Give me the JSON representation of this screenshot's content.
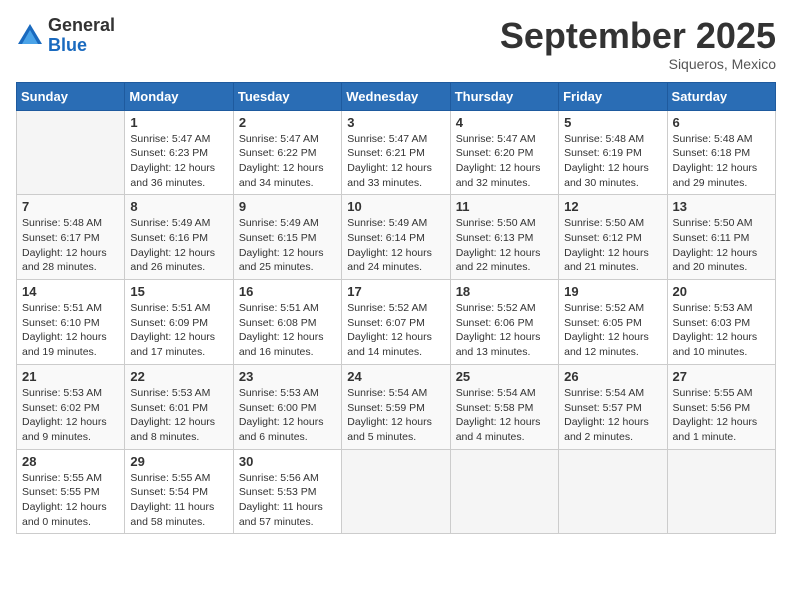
{
  "logo": {
    "general": "General",
    "blue": "Blue"
  },
  "title": {
    "month_year": "September 2025",
    "location": "Siqueros, Mexico"
  },
  "weekdays": [
    "Sunday",
    "Monday",
    "Tuesday",
    "Wednesday",
    "Thursday",
    "Friday",
    "Saturday"
  ],
  "weeks": [
    [
      {
        "day": "",
        "sunrise": "",
        "sunset": "",
        "daylight": ""
      },
      {
        "day": "1",
        "sunrise": "Sunrise: 5:47 AM",
        "sunset": "Sunset: 6:23 PM",
        "daylight": "Daylight: 12 hours and 36 minutes."
      },
      {
        "day": "2",
        "sunrise": "Sunrise: 5:47 AM",
        "sunset": "Sunset: 6:22 PM",
        "daylight": "Daylight: 12 hours and 34 minutes."
      },
      {
        "day": "3",
        "sunrise": "Sunrise: 5:47 AM",
        "sunset": "Sunset: 6:21 PM",
        "daylight": "Daylight: 12 hours and 33 minutes."
      },
      {
        "day": "4",
        "sunrise": "Sunrise: 5:47 AM",
        "sunset": "Sunset: 6:20 PM",
        "daylight": "Daylight: 12 hours and 32 minutes."
      },
      {
        "day": "5",
        "sunrise": "Sunrise: 5:48 AM",
        "sunset": "Sunset: 6:19 PM",
        "daylight": "Daylight: 12 hours and 30 minutes."
      },
      {
        "day": "6",
        "sunrise": "Sunrise: 5:48 AM",
        "sunset": "Sunset: 6:18 PM",
        "daylight": "Daylight: 12 hours and 29 minutes."
      }
    ],
    [
      {
        "day": "7",
        "sunrise": "Sunrise: 5:48 AM",
        "sunset": "Sunset: 6:17 PM",
        "daylight": "Daylight: 12 hours and 28 minutes."
      },
      {
        "day": "8",
        "sunrise": "Sunrise: 5:49 AM",
        "sunset": "Sunset: 6:16 PM",
        "daylight": "Daylight: 12 hours and 26 minutes."
      },
      {
        "day": "9",
        "sunrise": "Sunrise: 5:49 AM",
        "sunset": "Sunset: 6:15 PM",
        "daylight": "Daylight: 12 hours and 25 minutes."
      },
      {
        "day": "10",
        "sunrise": "Sunrise: 5:49 AM",
        "sunset": "Sunset: 6:14 PM",
        "daylight": "Daylight: 12 hours and 24 minutes."
      },
      {
        "day": "11",
        "sunrise": "Sunrise: 5:50 AM",
        "sunset": "Sunset: 6:13 PM",
        "daylight": "Daylight: 12 hours and 22 minutes."
      },
      {
        "day": "12",
        "sunrise": "Sunrise: 5:50 AM",
        "sunset": "Sunset: 6:12 PM",
        "daylight": "Daylight: 12 hours and 21 minutes."
      },
      {
        "day": "13",
        "sunrise": "Sunrise: 5:50 AM",
        "sunset": "Sunset: 6:11 PM",
        "daylight": "Daylight: 12 hours and 20 minutes."
      }
    ],
    [
      {
        "day": "14",
        "sunrise": "Sunrise: 5:51 AM",
        "sunset": "Sunset: 6:10 PM",
        "daylight": "Daylight: 12 hours and 19 minutes."
      },
      {
        "day": "15",
        "sunrise": "Sunrise: 5:51 AM",
        "sunset": "Sunset: 6:09 PM",
        "daylight": "Daylight: 12 hours and 17 minutes."
      },
      {
        "day": "16",
        "sunrise": "Sunrise: 5:51 AM",
        "sunset": "Sunset: 6:08 PM",
        "daylight": "Daylight: 12 hours and 16 minutes."
      },
      {
        "day": "17",
        "sunrise": "Sunrise: 5:52 AM",
        "sunset": "Sunset: 6:07 PM",
        "daylight": "Daylight: 12 hours and 14 minutes."
      },
      {
        "day": "18",
        "sunrise": "Sunrise: 5:52 AM",
        "sunset": "Sunset: 6:06 PM",
        "daylight": "Daylight: 12 hours and 13 minutes."
      },
      {
        "day": "19",
        "sunrise": "Sunrise: 5:52 AM",
        "sunset": "Sunset: 6:05 PM",
        "daylight": "Daylight: 12 hours and 12 minutes."
      },
      {
        "day": "20",
        "sunrise": "Sunrise: 5:53 AM",
        "sunset": "Sunset: 6:03 PM",
        "daylight": "Daylight: 12 hours and 10 minutes."
      }
    ],
    [
      {
        "day": "21",
        "sunrise": "Sunrise: 5:53 AM",
        "sunset": "Sunset: 6:02 PM",
        "daylight": "Daylight: 12 hours and 9 minutes."
      },
      {
        "day": "22",
        "sunrise": "Sunrise: 5:53 AM",
        "sunset": "Sunset: 6:01 PM",
        "daylight": "Daylight: 12 hours and 8 minutes."
      },
      {
        "day": "23",
        "sunrise": "Sunrise: 5:53 AM",
        "sunset": "Sunset: 6:00 PM",
        "daylight": "Daylight: 12 hours and 6 minutes."
      },
      {
        "day": "24",
        "sunrise": "Sunrise: 5:54 AM",
        "sunset": "Sunset: 5:59 PM",
        "daylight": "Daylight: 12 hours and 5 minutes."
      },
      {
        "day": "25",
        "sunrise": "Sunrise: 5:54 AM",
        "sunset": "Sunset: 5:58 PM",
        "daylight": "Daylight: 12 hours and 4 minutes."
      },
      {
        "day": "26",
        "sunrise": "Sunrise: 5:54 AM",
        "sunset": "Sunset: 5:57 PM",
        "daylight": "Daylight: 12 hours and 2 minutes."
      },
      {
        "day": "27",
        "sunrise": "Sunrise: 5:55 AM",
        "sunset": "Sunset: 5:56 PM",
        "daylight": "Daylight: 12 hours and 1 minute."
      }
    ],
    [
      {
        "day": "28",
        "sunrise": "Sunrise: 5:55 AM",
        "sunset": "Sunset: 5:55 PM",
        "daylight": "Daylight: 12 hours and 0 minutes."
      },
      {
        "day": "29",
        "sunrise": "Sunrise: 5:55 AM",
        "sunset": "Sunset: 5:54 PM",
        "daylight": "Daylight: 11 hours and 58 minutes."
      },
      {
        "day": "30",
        "sunrise": "Sunrise: 5:56 AM",
        "sunset": "Sunset: 5:53 PM",
        "daylight": "Daylight: 11 hours and 57 minutes."
      },
      {
        "day": "",
        "sunrise": "",
        "sunset": "",
        "daylight": ""
      },
      {
        "day": "",
        "sunrise": "",
        "sunset": "",
        "daylight": ""
      },
      {
        "day": "",
        "sunrise": "",
        "sunset": "",
        "daylight": ""
      },
      {
        "day": "",
        "sunrise": "",
        "sunset": "",
        "daylight": ""
      }
    ]
  ]
}
